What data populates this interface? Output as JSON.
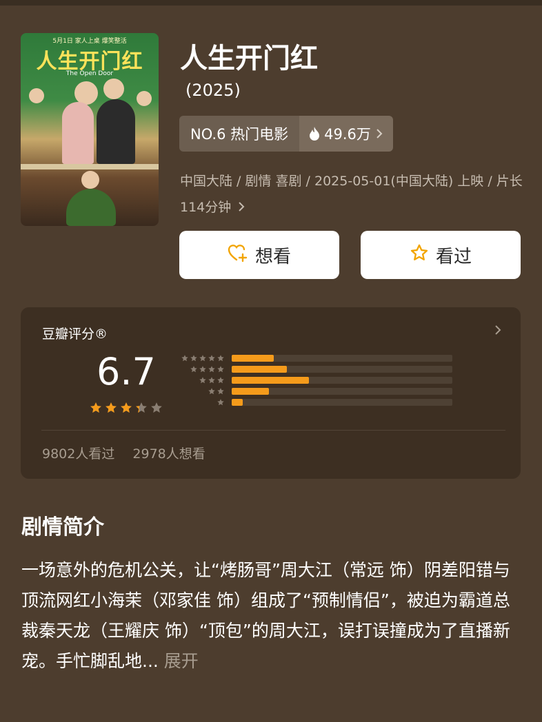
{
  "movie": {
    "title": "人生开门红",
    "year": "(2025)",
    "rank": "NO.6 热门电影",
    "heat": "49.6万",
    "meta": "中国大陆 / 剧情 喜剧 / 2025-05-01(中国大陆) 上映 / 片长114分钟"
  },
  "poster": {
    "top_text": "5月1日 家人上桌 爆笑整活",
    "title_text": "人生开门红",
    "subtitle_text": "The Open Door"
  },
  "buttons": {
    "want": "想看",
    "seen": "看过"
  },
  "rating": {
    "label": "豆瓣评分®",
    "score": "6.7",
    "star_fraction": 0.67,
    "distribution": [
      {
        "stars": 5,
        "fraction": 0.19
      },
      {
        "stars": 4,
        "fraction": 0.25
      },
      {
        "stars": 3,
        "fraction": 0.35
      },
      {
        "stars": 2,
        "fraction": 0.17
      },
      {
        "stars": 1,
        "fraction": 0.05
      }
    ],
    "seen_count": "9802人看过",
    "want_count": "2978人想看"
  },
  "synopsis": {
    "heading": "剧情简介",
    "text": "一场意外的危机公关，让“烤肠哥”周大江（常远 饰）阴差阳错与顶流网红小海茉（邓家佳 饰）组成了“预制情侣”，被迫为霸道总裁秦天龙（王耀庆 饰）“顶包”的周大江，误打误撞成为了直播新宠。手忙脚乱地...",
    "more": "展开"
  },
  "colors": {
    "background": "#4d3d2e",
    "card": "#3d2f22",
    "accent": "#f59b1b",
    "muted_text": "#a89d90"
  },
  "icons": {
    "heat": "flame-icon",
    "want": "heart-plus-icon",
    "seen": "star-outline-icon",
    "chevron": "chevron-right-icon"
  }
}
